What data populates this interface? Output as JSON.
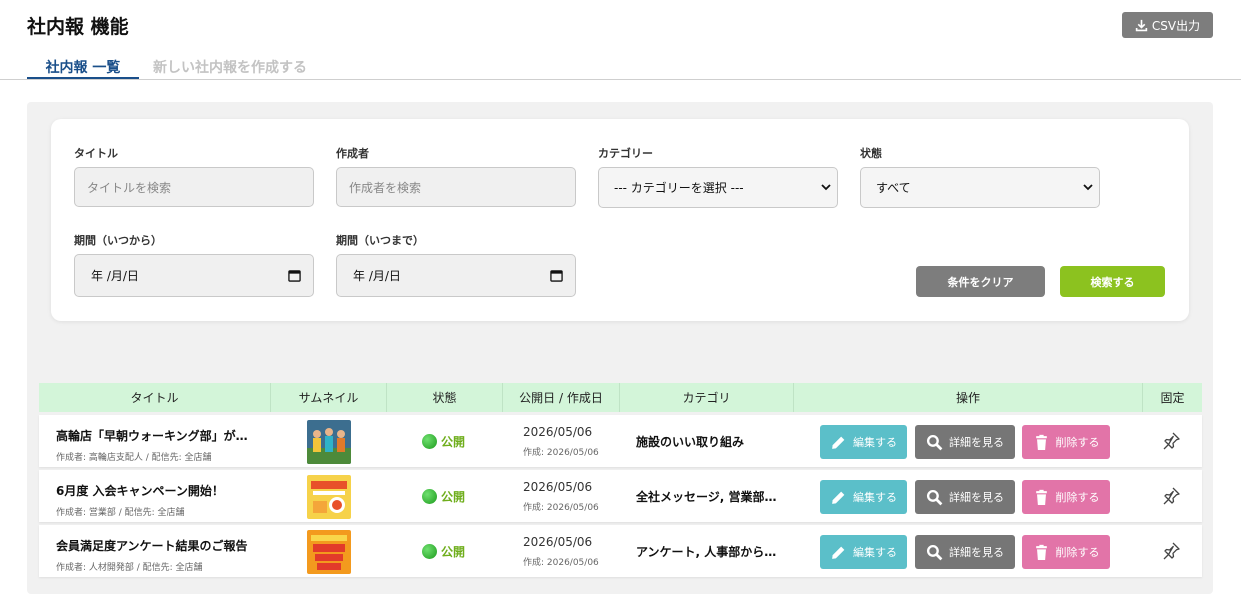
{
  "page": {
    "title": "社内報 機能",
    "csv_button": "CSV出力"
  },
  "tabs": [
    {
      "label": "社内報 一覧",
      "active": true
    },
    {
      "label": "新しい社内報を作成する",
      "active": false
    }
  ],
  "filters": {
    "title": {
      "label": "タイトル",
      "placeholder": "タイトルを検索"
    },
    "author": {
      "label": "作成者",
      "placeholder": "作成者を検索"
    },
    "category": {
      "label": "カテゴリー",
      "selected": "--- カテゴリーを選択 ---"
    },
    "status": {
      "label": "状態",
      "selected": "すべて"
    },
    "date_from": {
      "label": "期間（いつから）",
      "value": "年 /月/日"
    },
    "date_to": {
      "label": "期間（いつまで）",
      "value": "年 /月/日"
    },
    "clear_button": "条件をクリア",
    "search_button": "検索する"
  },
  "table": {
    "headers": [
      "タイトル",
      "サムネイル",
      "状態",
      "公開日 / 作成日",
      "カテゴリ",
      "操作",
      "固定"
    ],
    "actions": {
      "edit": "編集する",
      "detail": "詳細を見る",
      "delete": "削除する"
    },
    "rows": [
      {
        "title": "高輪店「早朝ウォーキング部」が…",
        "meta": "作成者: 高輪店支配人 / 配信先: 全店舗",
        "status": "公開",
        "published": "2026/05/06",
        "created": "作成: 2026/05/06",
        "category": "施設のいい取り組み"
      },
      {
        "title": "6月度 入会キャンペーン開始！",
        "meta": "作成者: 営業部 / 配信先: 全店舗",
        "status": "公開",
        "published": "2026/05/06",
        "created": "作成: 2026/05/06",
        "category": "全社メッセージ, 営業部…"
      },
      {
        "title": "会員満足度アンケート結果のご報告",
        "meta": "作成者: 人材開発部 / 配信先: 全店舗",
        "status": "公開",
        "published": "2026/05/06",
        "created": "作成: 2026/05/06",
        "category": "アンケート, 人事部から…"
      }
    ]
  },
  "colors": {
    "accent": "#1a4f8a",
    "header_green": "#d3f5d9",
    "search_green": "#8cc21f",
    "edit": "#5bbfc9",
    "detail": "#767676",
    "delete": "#e274a8",
    "status_green": "#6fae1c"
  }
}
